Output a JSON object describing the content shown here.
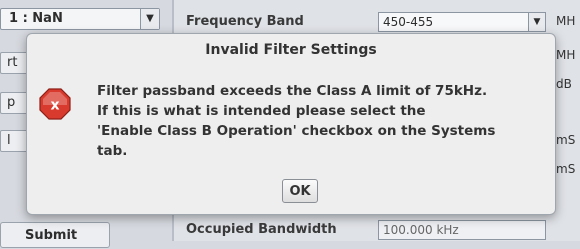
{
  "background": {
    "combo_value": "1 : NaN",
    "left_buttons": [
      "rt",
      "p",
      "l"
    ],
    "submit_label": "Submit",
    "properties": [
      {
        "label": "Frequency Band",
        "value": "450-455",
        "unit": "MH"
      },
      {
        "label": "",
        "value": "",
        "unit": "MH"
      },
      {
        "label": "",
        "value": "",
        "unit": "dB"
      },
      {
        "label": "",
        "value": "",
        "unit": "mS"
      },
      {
        "label": "",
        "value": "",
        "unit": "mS"
      },
      {
        "label": "Occupied Bandwidth",
        "value": "100.000 kHz",
        "unit": ""
      }
    ]
  },
  "dialog": {
    "title": "Invalid Filter Settings",
    "icon": "error-x-icon",
    "message_lines": [
      "Filter passband exceeds the Class A limit of 75kHz.",
      "If this is what is intended please select the",
      "'Enable Class B Operation' checkbox on the Systems",
      "tab."
    ],
    "ok_label": "OK"
  },
  "colors": {
    "error_icon": "#d83a2e",
    "dialog_bg": "#eeeeee"
  }
}
